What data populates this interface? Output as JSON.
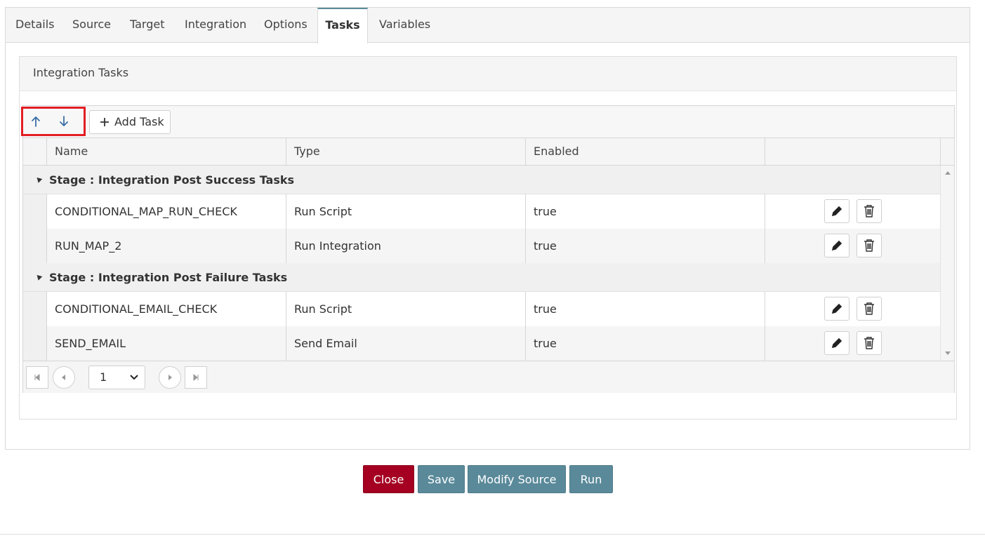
{
  "tabs": [
    {
      "label": "Details"
    },
    {
      "label": "Source"
    },
    {
      "label": "Target"
    },
    {
      "label": "Integration"
    },
    {
      "label": "Options"
    },
    {
      "label": "Tasks",
      "active": true
    },
    {
      "label": "Variables"
    }
  ],
  "panel": {
    "title": "Integration Tasks"
  },
  "toolbar": {
    "add_task_label": "Add Task"
  },
  "table": {
    "columns": [
      "Name",
      "Type",
      "Enabled",
      ""
    ],
    "groups": [
      {
        "label": "Stage : Integration Post Success Tasks",
        "rows": [
          {
            "name": "CONDITIONAL_MAP_RUN_CHECK",
            "type": "Run Script",
            "enabled": "true"
          },
          {
            "name": "RUN_MAP_2",
            "type": "Run Integration",
            "enabled": "true"
          }
        ]
      },
      {
        "label": "Stage : Integration Post Failure Tasks",
        "rows": [
          {
            "name": "CONDITIONAL_EMAIL_CHECK",
            "type": "Run Script",
            "enabled": "true"
          },
          {
            "name": "SEND_EMAIL",
            "type": "Send Email",
            "enabled": "true"
          }
        ]
      }
    ]
  },
  "pager": {
    "page": "1"
  },
  "actions": {
    "close": "Close",
    "save": "Save",
    "modify_source": "Modify Source",
    "run": "Run"
  },
  "colors": {
    "accent": "#5a8a9a",
    "close": "#a50021",
    "highlight": "#e31e24",
    "arrow": "#3a6ea5"
  },
  "icons": {
    "move_up": "arrow-up-icon",
    "move_down": "arrow-down-icon",
    "add": "plus-icon",
    "edit": "pencil-icon",
    "delete": "trash-icon"
  }
}
